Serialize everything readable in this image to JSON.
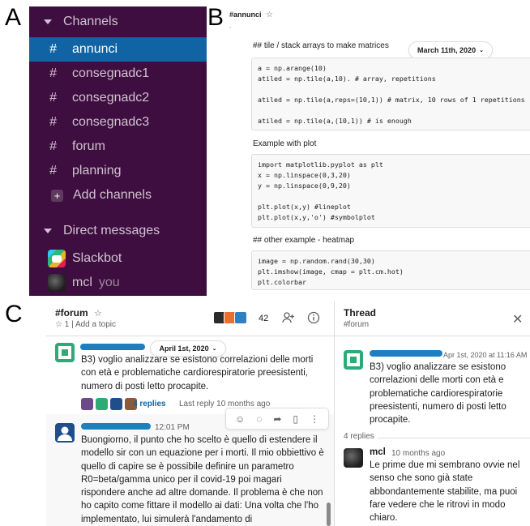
{
  "panel_labels": {
    "a": "A",
    "b": "B",
    "c": "C"
  },
  "sidebar": {
    "channels_header": "Channels",
    "channels": [
      {
        "label": "annunci",
        "active": true
      },
      {
        "label": "consegnadc1",
        "active": false
      },
      {
        "label": "consegnadc2",
        "active": false
      },
      {
        "label": "consegnadc3",
        "active": false
      },
      {
        "label": "forum",
        "active": false
      },
      {
        "label": "planning",
        "active": false
      }
    ],
    "hash": "#",
    "add_channels": "Add channels",
    "dm_header": "Direct messages",
    "dms": [
      {
        "label": "Slackbot",
        "suffix": ""
      },
      {
        "label": "mcl",
        "suffix": "you"
      }
    ]
  },
  "snippet": {
    "channel": "#annunci",
    "star": "☆",
    "dot": ".",
    "date_pill": "March 11th, 2020",
    "heading1": "## tile / stack arrays to make matrices",
    "code1": "a = np.arange(10)\natiled = np.tile(a,10). # array, repetitions\n\natiled = np.tile(a,reps=(10,1)) # matrix, 10 rows of 1 repetitions\n\natiled = np.tile(a,(10,1)) # is enough",
    "heading2": "Example with plot",
    "code2": "import matplotlib.pyplot as plt\nx = np.linspace(0,3,20)\ny = np.linspace(0,9,20)\n\nplt.plot(x,y) #lineplot\nplt.plot(x,y,'o') #symbolplot",
    "heading3": "## other example - heatmap",
    "code3": "image = np.random.rand(30,30)\nplt.imshow(image, cmap = plt.cm.hot)\nplt.colorbar"
  },
  "forum": {
    "channel": "#forum",
    "star": "☆",
    "members_pin": "☆ 1",
    "add_topic": "Add a topic",
    "separator": "|",
    "member_count": "42",
    "date_pill": "April 1st, 2020",
    "msg1_text": "B3) voglio analizzare se esistono correlazioni delle morti con età e problematiche cardiorespiratorie preesistenti,  numero di posti letto procapite.",
    "replies": "4 replies",
    "last_reply": "Last reply 10 months ago",
    "msg2_time": "12:01 PM",
    "msg2_text": "Buongiorno, il punto che ho scelto è quello di estendere il modello sir con un equazione per i morti. Il mio obbiettivo è quello di capire se è possibile definire un parametro R0=beta/gamma unico per il covid-19 poi magari rispondere anche ad altre domande. Il problema è che non ho capito come fittare il modello ai dati: Una volta che l'ho implementato, lui simulerà l'andamento di"
  },
  "thread": {
    "title": "Thread",
    "subtitle": "#forum",
    "close": "✕",
    "parent_time": "Apr 1st, 2020 at 11:16 AM",
    "parent_text": "B3) voglio analizzare se esistono correlazioni delle morti con età e problematiche cardiorespiratorie preesistenti,  numero di posti letto procapite.",
    "replies_label": "4 replies",
    "reply_name": "mcl",
    "reply_time": "10 months ago",
    "reply_text": "Le prime due mi sembrano ovvie nel senso che sono già state abbondantemente stabilite, ma puoi fare vedere che le ritrovi in modo chiaro."
  },
  "colors": {
    "sidebar_bg": "#3f0e40",
    "sidebar_active": "#1164a3",
    "link_blue": "#1264a3",
    "redaction": "#1d7fbf",
    "avatar_green": "#2bac76",
    "avatar_navy": "#1f4e8c"
  },
  "icons": {
    "channels_caret": "caret-down-icon",
    "dm_caret": "caret-down-icon",
    "add": "plus-icon",
    "add_member": "add-person-icon",
    "info": "info-icon",
    "emoji": "emoji-icon",
    "reply": "thread-icon",
    "share": "share-icon",
    "bookmark": "bookmark-icon",
    "more": "more-vertical-icon"
  }
}
